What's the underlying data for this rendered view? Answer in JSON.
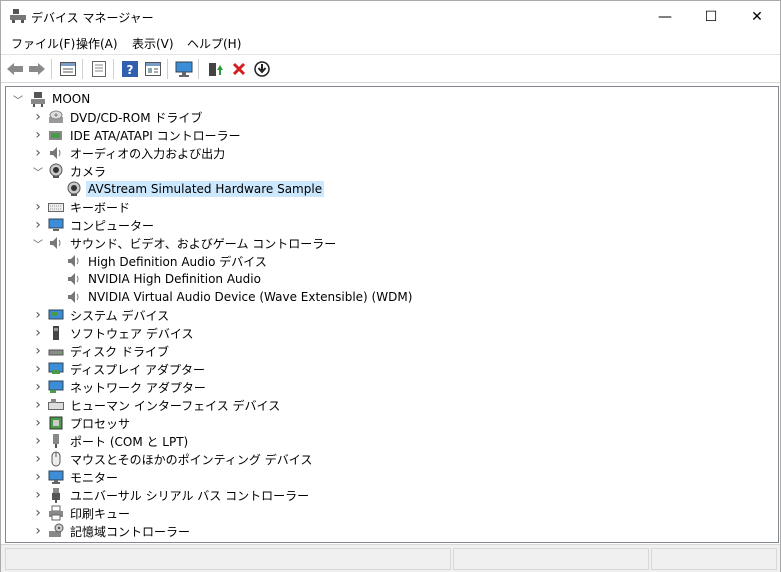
{
  "window": {
    "title": "デバイス マネージャー",
    "minimize": "—",
    "maximize": "☐",
    "close": "✕"
  },
  "menu": [
    "ファイル(F)",
    "操作(A)",
    "表示(V)",
    "ヘルプ(H)"
  ],
  "toolbar": {
    "buttons": [
      "back-icon",
      "forward-icon",
      "properties-icon",
      "hidden-list-icon",
      "help-icon",
      "view-icon",
      "monitor-icon",
      "update-driver-icon",
      "uninstall-icon",
      "download-icon"
    ]
  },
  "tree": {
    "root": "MOON",
    "items": [
      {
        "label": "DVD/CD-ROM ドライブ",
        "icon": "dvd-icon",
        "expanded": false
      },
      {
        "label": "IDE ATA/ATAPI コントローラー",
        "icon": "controller-icon",
        "expanded": false
      },
      {
        "label": "オーディオの入力および出力",
        "icon": "audio-icon",
        "expanded": false
      },
      {
        "label": "カメラ",
        "icon": "camera-icon",
        "expanded": true
      },
      {
        "label": "AVStream Simulated Hardware Sample",
        "icon": "camera-icon",
        "child": true,
        "selected": true
      },
      {
        "label": "キーボード",
        "icon": "keyboard-icon",
        "expanded": false
      },
      {
        "label": "コンピューター",
        "icon": "computer-icon",
        "expanded": false
      },
      {
        "label": "サウンド、ビデオ、およびゲーム コントローラー",
        "icon": "audio-icon",
        "expanded": true
      },
      {
        "label": "High Definition Audio デバイス",
        "icon": "audio-icon",
        "child": true
      },
      {
        "label": "NVIDIA High Definition Audio",
        "icon": "audio-icon",
        "child": true
      },
      {
        "label": "NVIDIA Virtual Audio Device (Wave Extensible) (WDM)",
        "icon": "audio-icon",
        "child": true
      },
      {
        "label": "システム デバイス",
        "icon": "system-icon",
        "expanded": false
      },
      {
        "label": "ソフトウェア デバイス",
        "icon": "software-icon",
        "expanded": false
      },
      {
        "label": "ディスク ドライブ",
        "icon": "disk-icon",
        "expanded": false
      },
      {
        "label": "ディスプレイ アダプター",
        "icon": "display-icon",
        "expanded": false
      },
      {
        "label": "ネットワーク アダプター",
        "icon": "network-icon",
        "expanded": false
      },
      {
        "label": "ヒューマン インターフェイス デバイス",
        "icon": "hid-icon",
        "expanded": false
      },
      {
        "label": "プロセッサ",
        "icon": "processor-icon",
        "expanded": false
      },
      {
        "label": "ポート (COM と LPT)",
        "icon": "port-icon",
        "expanded": false
      },
      {
        "label": "マウスとそのほかのポインティング デバイス",
        "icon": "mouse-icon",
        "expanded": false
      },
      {
        "label": "モニター",
        "icon": "monitor-icon",
        "expanded": false
      },
      {
        "label": "ユニバーサル シリアル バス コントローラー",
        "icon": "usb-icon",
        "expanded": false
      },
      {
        "label": "印刷キュー",
        "icon": "printer-icon",
        "expanded": false
      },
      {
        "label": "記憶域コントローラー",
        "icon": "storage-icon",
        "expanded": false
      }
    ]
  },
  "colors": {
    "selection": "#cce8ff",
    "accent": "#1e6fc7",
    "danger": "#d42020",
    "green": "#2a9a3a"
  }
}
